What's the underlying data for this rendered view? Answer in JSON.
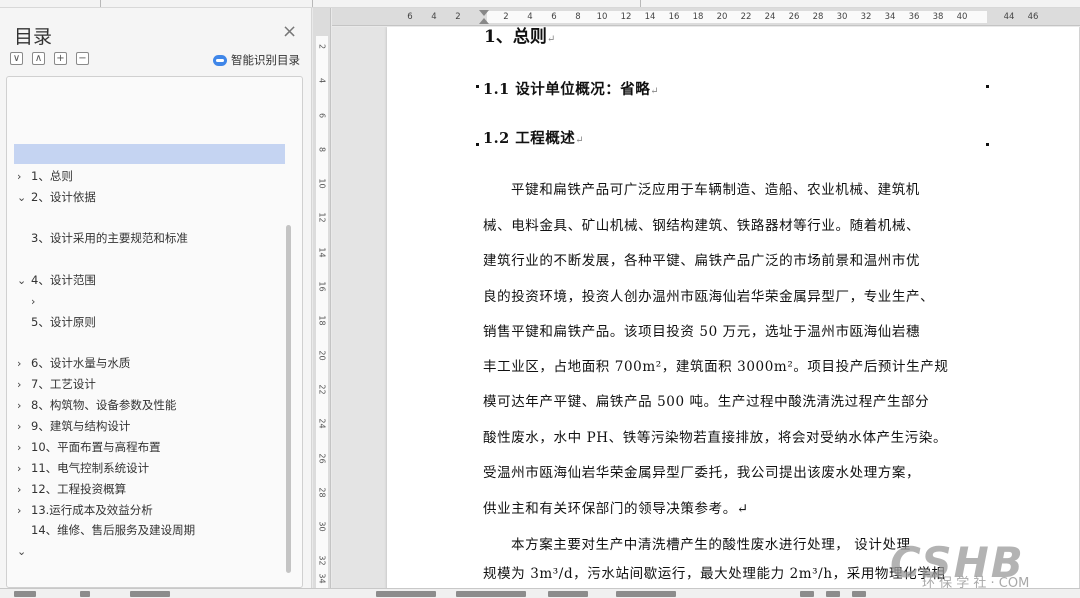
{
  "toc": {
    "title": "目录",
    "close_glyph": "×",
    "tools": [
      "∨",
      "∧",
      "+",
      "−"
    ],
    "smart_label": "智能识别目录",
    "items": [
      {
        "arrow": "›",
        "label": "1、总则"
      },
      {
        "arrow": "⌄",
        "label": "2、设计依据"
      },
      {
        "arrow": "",
        "label": "3、设计采用的主要规范和标准"
      },
      {
        "arrow": "⌄",
        "label": "4、设计范围"
      },
      {
        "arrow": "›",
        "label": ""
      },
      {
        "arrow": "",
        "label": "5、设计原则"
      },
      {
        "arrow": "›",
        "label": "6、设计水量与水质"
      },
      {
        "arrow": "›",
        "label": "7、工艺设计"
      },
      {
        "arrow": "›",
        "label": "8、构筑物、设备参数及性能"
      },
      {
        "arrow": "›",
        "label": "9、建筑与结构设计"
      },
      {
        "arrow": "›",
        "label": "10、平面布置与高程布置"
      },
      {
        "arrow": "›",
        "label": "11、电气控制系统设计"
      },
      {
        "arrow": "›",
        "label": "12、工程投资概算"
      },
      {
        "arrow": "›",
        "label": "13.运行成本及效益分析"
      },
      {
        "arrow": "",
        "label": "14、维修、售后服务及建设周期"
      },
      {
        "arrow": "⌄",
        "label": ""
      }
    ]
  },
  "ruler": {
    "h_numbers": [
      "6",
      "4",
      "2",
      "2",
      "4",
      "6",
      "8",
      "10",
      "12",
      "14",
      "16",
      "18",
      "20",
      "22",
      "24",
      "26",
      "28",
      "30",
      "32",
      "34",
      "36",
      "38",
      "40",
      "44",
      "46"
    ],
    "v_numbers": [
      "2",
      "4",
      "6",
      "8",
      "10",
      "12",
      "14",
      "16",
      "18",
      "20",
      "22",
      "24",
      "26",
      "28",
      "30",
      "32",
      "34"
    ]
  },
  "document": {
    "heading1": "1、总则",
    "heading1_mark": "↵",
    "heading_1_1": "1.1 设计单位概况：省略",
    "heading_1_2": "1.2 工程概述",
    "para_mark": "↵",
    "paragraph1": [
      "平键和扁铁产品可广泛应用于车辆制造、造船、农业机械、建筑机",
      "械、电料金具、矿山机械、钢结构建筑、铁路器材等行业。随着机械、",
      "建筑行业的不断发展，各种平键、扁铁产品广泛的市场前景和温州市优",
      "良的投资环境，投资人创办温州市瓯海仙岩华荣金属异型厂，专业生产、",
      "销售平键和扁铁产品。该项目投资 50 万元，选址于温州市瓯海仙岩穗",
      "丰工业区，占地面积 700m²，建筑面积 3000m²。项目投产后预计生产规",
      "模可达年产平键、扁铁产品 500 吨。生产过程中酸洗清洗过程产生部分",
      "酸性废水，水中 PH、铁等污染物若直接排放，将会对受纳水体产生污染。",
      "受温州市瓯海仙岩华荣金属异型厂委托，我公司提出该废水处理方案，",
      "供业主和有关环保部门的领导决策参考。↵"
    ],
    "paragraph2": [
      "本方案主要对生产中清洗槽产生的酸性废水进行处理， 设计处理",
      "规模为 3m³/d，污水站间歇运行，最大处理能力 2m³/h，采用物理化学相"
    ]
  },
  "watermark": {
    "big": "CSHB",
    "small": "环 保 学 社 · COM"
  }
}
